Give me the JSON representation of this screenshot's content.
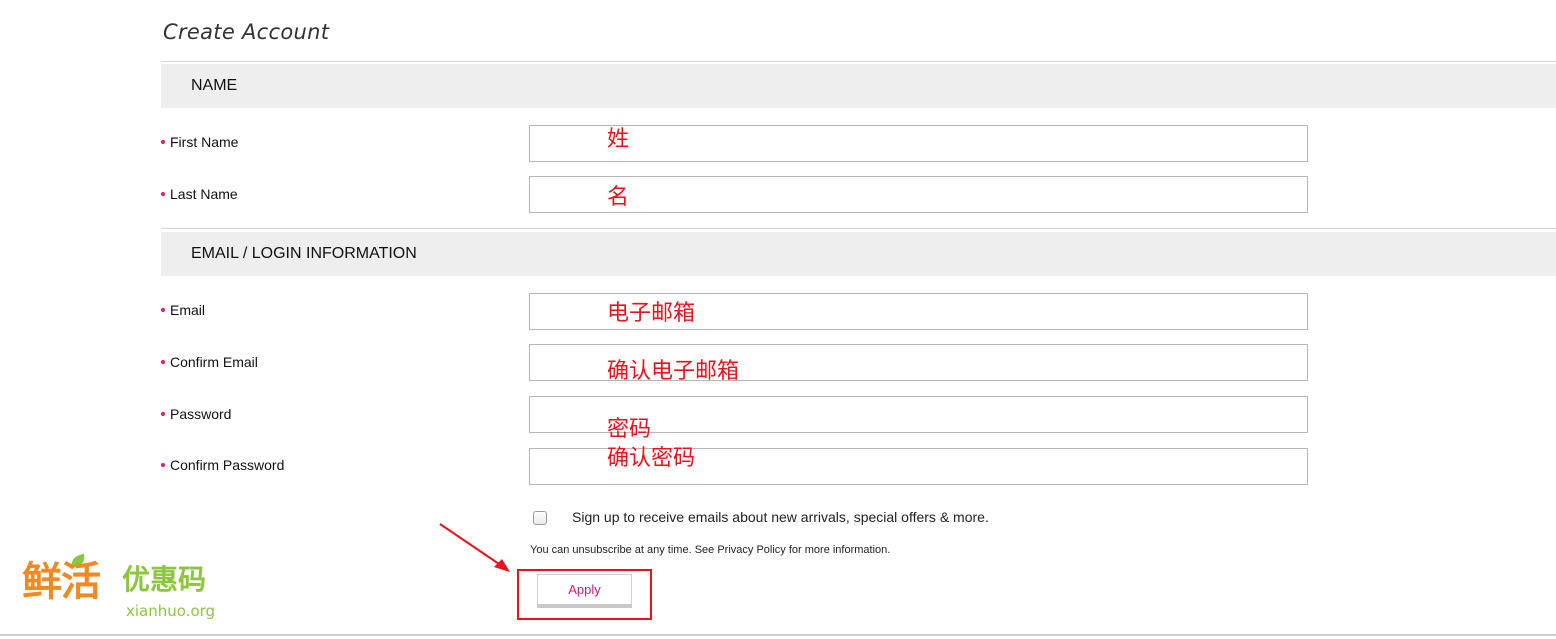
{
  "page": {
    "title": "Create Account"
  },
  "sections": {
    "name": {
      "title": "NAME"
    },
    "email_login": {
      "title": "EMAIL / LOGIN INFORMATION"
    }
  },
  "fields": {
    "first_name": {
      "label": "First Name",
      "value": "",
      "annotation": "姓"
    },
    "last_name": {
      "label": "Last Name",
      "value": "",
      "annotation": "名"
    },
    "email": {
      "label": "Email",
      "value": "",
      "annotation": "电子邮箱"
    },
    "confirm_email": {
      "label": "Confirm Email",
      "value": "",
      "annotation": "确认电子邮箱"
    },
    "password": {
      "label": "Password",
      "value": "",
      "annotation": "密码"
    },
    "confirm_password": {
      "label": "Confirm Password",
      "value": "",
      "annotation": "确认密码"
    }
  },
  "newsletter": {
    "checked": false,
    "label": "Sign up to receive emails about new arrivals, special offers & more.",
    "note_prefix": "You can unsubscribe at any time. See ",
    "privacy_link": "Privacy Policy",
    "note_suffix": " for more information."
  },
  "actions": {
    "apply_label": "Apply"
  },
  "watermark": {
    "brand": "鲜活",
    "tagline": "优惠码",
    "url": "xianhuo.org"
  },
  "colors": {
    "required_dot": "#e0197d",
    "annotation_red": "#e8141d",
    "apply_text": "#d01b7b",
    "section_bg": "#eeeeee",
    "watermark_orange": "#f08a24",
    "watermark_green": "#8cc63f"
  },
  "icons": {
    "arrow": "red-pointer-arrow-icon"
  }
}
